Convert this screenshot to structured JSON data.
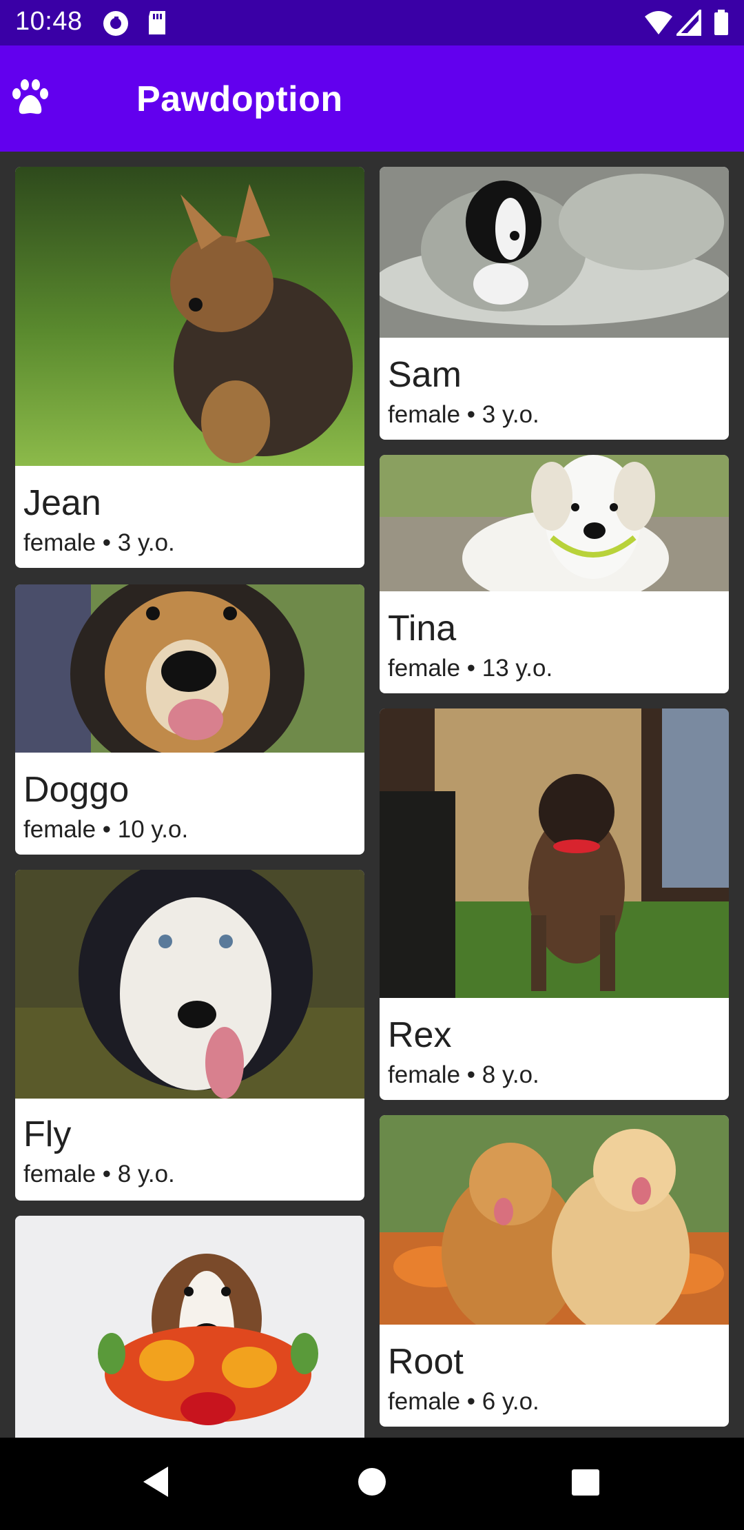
{
  "status_bar": {
    "time": "10:48",
    "left_icons": [
      "pocket-casts-icon",
      "sd-card-icon"
    ],
    "right_icons": [
      "wifi-icon",
      "signal-icon",
      "battery-icon"
    ]
  },
  "app_bar": {
    "title": "Pawdoption",
    "icon": "paw-icon",
    "color": "#6200ee"
  },
  "dogs": [
    {
      "name": "Jean",
      "info": "female • 3 y.o."
    },
    {
      "name": "Sam",
      "info": "female • 3 y.o."
    },
    {
      "name": "Tina",
      "info": "female • 13 y.o."
    },
    {
      "name": "Doggo",
      "info": "female • 10 y.o."
    },
    {
      "name": "Rex",
      "info": "female • 8 y.o."
    },
    {
      "name": "Fly",
      "info": "female • 8 y.o."
    },
    {
      "name": "Root",
      "info": "female • 6 y.o."
    }
  ],
  "nav_bar": {
    "buttons": [
      "back-icon",
      "home-icon",
      "recents-icon"
    ]
  }
}
